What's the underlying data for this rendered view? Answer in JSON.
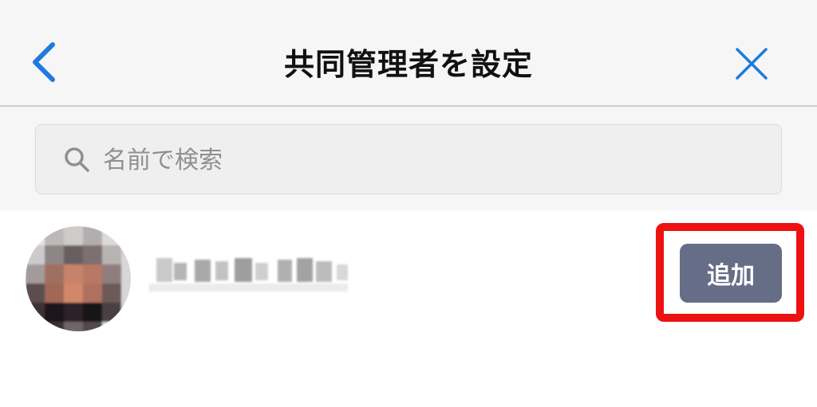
{
  "header": {
    "title": "共同管理者を設定",
    "back_icon": "chevron-left-icon",
    "close_icon": "close-icon",
    "accent_color": "#1f7ae0"
  },
  "search": {
    "placeholder": "名前で検索",
    "value": "",
    "icon": "search-icon"
  },
  "users": [
    {
      "add_label": "追加"
    }
  ],
  "colors": {
    "add_button": "#666e87",
    "highlight": "#ee1111",
    "header_bg": "#f6f6f6"
  }
}
